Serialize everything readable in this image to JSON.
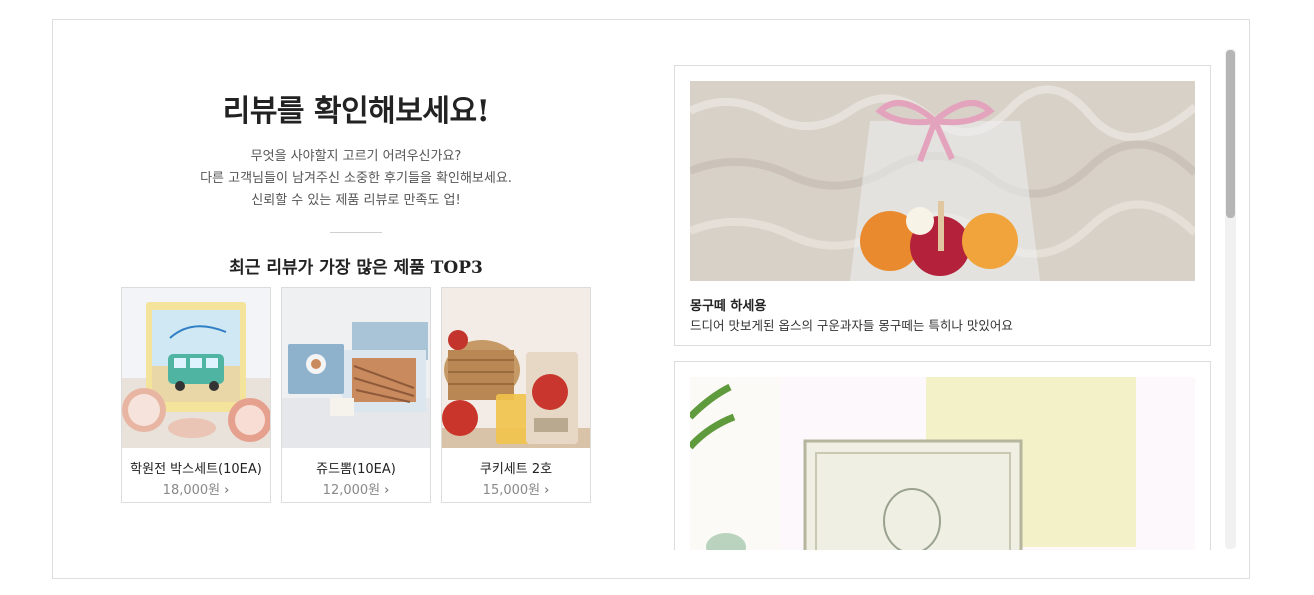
{
  "hero": {
    "title": "리뷰를 확인해보세요!",
    "desc_line1": "무엇을 사야할지 고르기 어려우신가요?",
    "desc_line2": "다른 고객님들이 남겨주신 소중한 후기들을 확인해보세요.",
    "desc_line3": "신뢰할 수 있는 제품 리뷰로 만족도 업!",
    "top3_title": "최근 리뷰가 가장 많은 제품 TOP3"
  },
  "products": [
    {
      "name": "학원전 박스세트(10EA)",
      "price": "18,000원"
    },
    {
      "name": "쥬드뽐(10EA)",
      "price": "12,000원"
    },
    {
      "name": "쿠키세트 2호",
      "price": "15,000원"
    }
  ],
  "reviews": [
    {
      "title": "몽구떼 하세용",
      "text": "드디어 맛보게된 옵스의 구운과자들 몽구떼는 특히나 맛있어요"
    },
    {
      "title": "",
      "text": ""
    }
  ],
  "colors": {
    "border": "#dedede",
    "text": "#222222",
    "muted": "#888888",
    "scrollbar": "#b5b5b5"
  },
  "icons": {
    "price_arrow": "chevron-right-icon"
  }
}
